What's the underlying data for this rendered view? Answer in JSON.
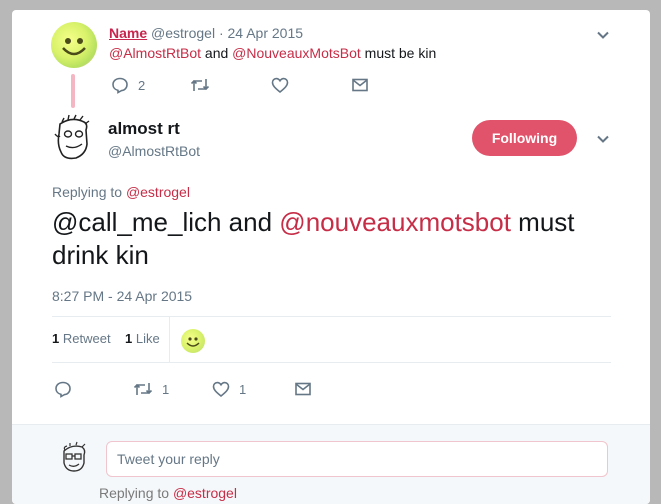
{
  "parent_tweet": {
    "name": "Name",
    "handle": "@estrogel",
    "date": "24 Apr 2015",
    "text_mention_1": "@AlmostRtBot",
    "text_and": "and",
    "text_mention_2": "@NouveauxMotsBot",
    "text_rest": "must be kin",
    "reply_count": "2",
    "icons": [
      "reply-icon",
      "retweet-icon",
      "heart-icon",
      "dm-icon"
    ]
  },
  "main_tweet": {
    "name": "almost rt",
    "handle": "@AlmostRtBot",
    "follow_label": "Following",
    "replying_prefix": "Replying to",
    "replying_handle": "@estrogel",
    "text_part_1": "@call_me_lich and",
    "text_mention": "@nouveauxmotsbot",
    "text_part_2": "must drink kin",
    "timestamp": "8:27 PM - 24 Apr 2015",
    "retweet_count": "1",
    "retweet_label": "Retweet",
    "like_count": "1",
    "like_label": "Like",
    "action_retweets": "1",
    "action_likes": "1"
  },
  "reply_box": {
    "placeholder": "Tweet your reply"
  },
  "next_tweet": {
    "replying_prefix": "Replying to",
    "replying_handle": "@estrogel"
  },
  "colors": {
    "accent": "#e0536a",
    "mention": "#c62d47",
    "muted": "#657786"
  }
}
